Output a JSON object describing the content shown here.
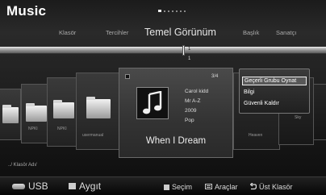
{
  "header": {
    "title": "Music",
    "page_dots": 7,
    "active_dot": 0
  },
  "sort_tabs": [
    {
      "label": "Klasör",
      "active": false
    },
    {
      "label": "Tercihler",
      "active": false
    },
    {
      "label": "Temel Görünüm",
      "active": true
    },
    {
      "label": "Başlık",
      "active": false
    },
    {
      "label": "Sanatçı",
      "active": false
    }
  ],
  "track": {
    "marker_label": "1",
    "count_label": "1"
  },
  "shelf_cards": [
    "NPKI",
    "NPKI",
    "usermanual",
    "Heaven",
    "Sky"
  ],
  "focused_item": {
    "position": "3/4",
    "artist": "Carol kidd",
    "album": "Mr A-Z",
    "year": "2009",
    "genre": "Pop",
    "title": "When I Dream"
  },
  "tools_menu": {
    "items": [
      "Geçerli Grubu Oynat",
      "Bilgi",
      "Güvenli Kaldır"
    ],
    "selected_index": 0
  },
  "path": "../ Klasör Adı/",
  "bottom_bar": {
    "devices": [
      {
        "icon": "usb-icon",
        "label": "USB"
      },
      {
        "icon": "device-icon",
        "label": "Aygıt"
      }
    ],
    "hints": [
      {
        "icon": "select-icon",
        "label": "Seçim"
      },
      {
        "icon": "tools-icon",
        "label": "Araçlar"
      },
      {
        "icon": "return-icon",
        "label": "Üst Klasör"
      }
    ]
  },
  "colors": {
    "background": "#1e1e1e",
    "menu_highlight": "#585858",
    "text": "#ffffff"
  }
}
